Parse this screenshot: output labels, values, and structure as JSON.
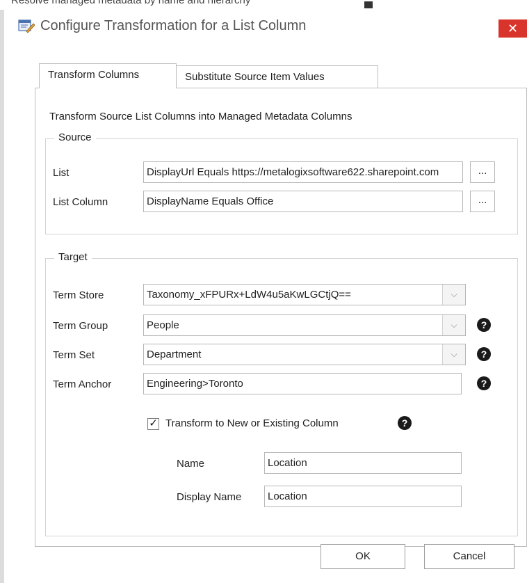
{
  "background_window": {
    "text": "Resolve managed metadata by name and hierarchy"
  },
  "dialog": {
    "title": "Configure Transformation for a List Column",
    "close_label": "✕",
    "title_icon": "edit-list-icon"
  },
  "tabs": [
    {
      "label": "Transform Columns",
      "active": true
    },
    {
      "label": "Substitute Source Item Values",
      "active": false
    }
  ],
  "description": "Transform Source List Columns into Managed Metadata Columns",
  "source": {
    "group_label": "Source",
    "list_label": "List",
    "list_value": "DisplayUrl Equals https://metalogixsoftware622.sharepoint.com",
    "list_column_label": "List Column",
    "list_column_value": "DisplayName Equals Office",
    "browse_label": "..."
  },
  "target": {
    "group_label": "Target",
    "term_store_label": "Term Store",
    "term_store_value": "Taxonomy_xFPURx+LdW4u5aKwLGCtjQ==",
    "term_group_label": "Term Group",
    "term_group_value": "People",
    "term_set_label": "Term Set",
    "term_set_value": "Department",
    "term_anchor_label": "Term Anchor",
    "term_anchor_value": "Engineering>Toronto",
    "transform_checkbox_label": "Transform to New or Existing Column",
    "transform_checked": true,
    "check_glyph": "✓",
    "name_label": "Name",
    "name_value": "Location",
    "display_name_label": "Display Name",
    "display_name_value": "Location",
    "help_glyph": "?",
    "dropdown_glyph": "⌵"
  },
  "footer": {
    "ok_label": "OK",
    "cancel_label": "Cancel"
  },
  "colors": {
    "close_button": "#d9342b",
    "help_icon": "#1a1a1a",
    "border": "#bdbdbd"
  }
}
